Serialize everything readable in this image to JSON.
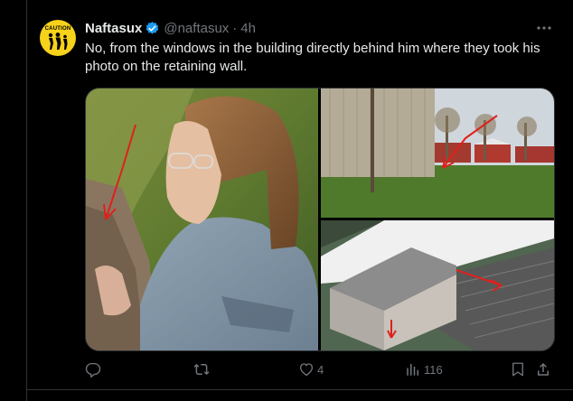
{
  "tweet": {
    "avatar": {
      "caution_label": "CAUTION",
      "background": "#f6d21a"
    },
    "display_name": "Naftasux",
    "verified": true,
    "handle": "@naftasux",
    "separator": "·",
    "time": "4h",
    "text": "No, from the windows in the building directly behind him where they took his photo on the retaining wall.",
    "media": [
      {
        "icon": "photo-person-closeup"
      },
      {
        "icon": "photo-building-field"
      },
      {
        "icon": "photo-aerial-building"
      }
    ],
    "actions": {
      "reply": {
        "icon": "reply-icon",
        "count": ""
      },
      "retweet": {
        "icon": "retweet-icon",
        "count": ""
      },
      "like": {
        "icon": "heart-icon",
        "count": "4"
      },
      "views": {
        "icon": "views-icon",
        "count": "116"
      },
      "bookmark": {
        "icon": "bookmark-icon"
      },
      "share": {
        "icon": "share-icon"
      }
    }
  },
  "colors": {
    "background": "#000000",
    "text": "#e7e9ea",
    "secondary_text": "#71767b",
    "border": "#2f3336",
    "verified_badge": "#1d9bf0",
    "annotation_arrow": "#e0201c"
  }
}
